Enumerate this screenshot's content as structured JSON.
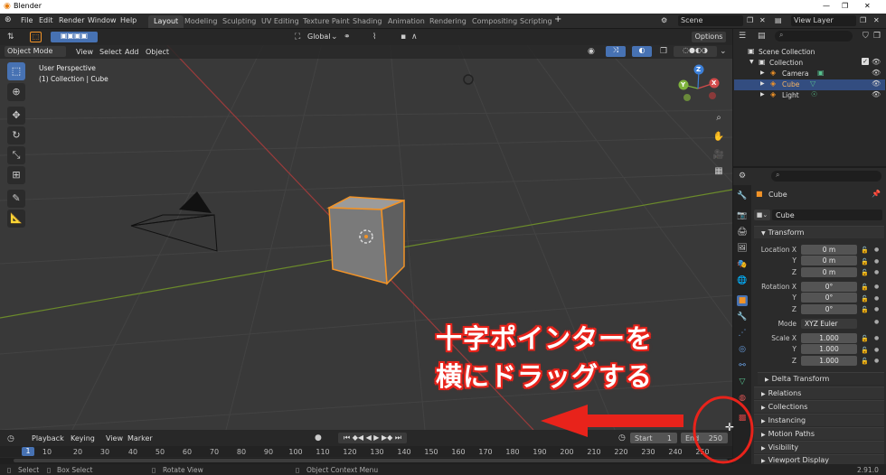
{
  "window": {
    "title": "Blender"
  },
  "menubar": {
    "items": [
      "File",
      "Edit",
      "Render",
      "Window",
      "Help"
    ],
    "workspaces": [
      "Layout",
      "Modeling",
      "Sculpting",
      "UV Editing",
      "Texture Paint",
      "Shading",
      "Animation",
      "Rendering",
      "Compositing",
      "Scripting"
    ],
    "active_workspace": "Layout",
    "add_tab": "+",
    "scene": "Scene",
    "view_layer": "View Layer"
  },
  "viewport": {
    "transform_orientation": "Global",
    "mode": "Object Mode",
    "menus": [
      "View",
      "Select",
      "Add",
      "Object"
    ],
    "overlay_title": "User Perspective",
    "overlay_sub": "(1) Collection | Cube",
    "options_label": "Options"
  },
  "gizmo": {
    "x": "X",
    "y": "Y",
    "z": "Z"
  },
  "outliner": {
    "root": "Scene Collection",
    "collection": "Collection",
    "items": [
      {
        "name": "Camera"
      },
      {
        "name": "Cube",
        "selected": true
      },
      {
        "name": "Light"
      }
    ]
  },
  "properties": {
    "object_name": "Cube",
    "datablock_name": "Cube",
    "section_transform": "Transform",
    "location": {
      "label": "Location X",
      "y": "Y",
      "z": "Z",
      "values": [
        "0 m",
        "0 m",
        "0 m"
      ]
    },
    "rotation": {
      "label": "Rotation X",
      "y": "Y",
      "z": "Z",
      "values": [
        "0°",
        "0°",
        "0°"
      ]
    },
    "mode": {
      "label": "Mode",
      "value": "XYZ Euler"
    },
    "scale": {
      "label": "Scale X",
      "y": "Y",
      "z": "Z",
      "values": [
        "1.000",
        "1.000",
        "1.000"
      ]
    },
    "sections": [
      "Delta Transform",
      "Relations",
      "Collections",
      "Instancing",
      "Motion Paths",
      "Visibility",
      "Viewport Display"
    ]
  },
  "timeline": {
    "menus": [
      "Playback",
      "Keying",
      "View",
      "Marker"
    ],
    "start_label": "Start",
    "start": "1",
    "end_label": "End",
    "end": "250",
    "frames": [
      "1",
      "10",
      "20",
      "30",
      "40",
      "50",
      "60",
      "70",
      "80",
      "90",
      "100",
      "110",
      "120",
      "130",
      "140",
      "150",
      "160",
      "170",
      "180",
      "190",
      "200",
      "210",
      "220",
      "230",
      "240",
      "250"
    ],
    "current": "1"
  },
  "statusbar": {
    "select": "Select",
    "box_select": "Box Select",
    "rotate": "Rotate View",
    "context_menu": "Object Context Menu",
    "version": "2.91.0"
  },
  "annotation": {
    "line1": "十字ポインターを",
    "line2": "横にドラッグする"
  },
  "colors": {
    "accent": "#4772b3",
    "selection": "#f29327",
    "annotation": "#e8231b"
  }
}
